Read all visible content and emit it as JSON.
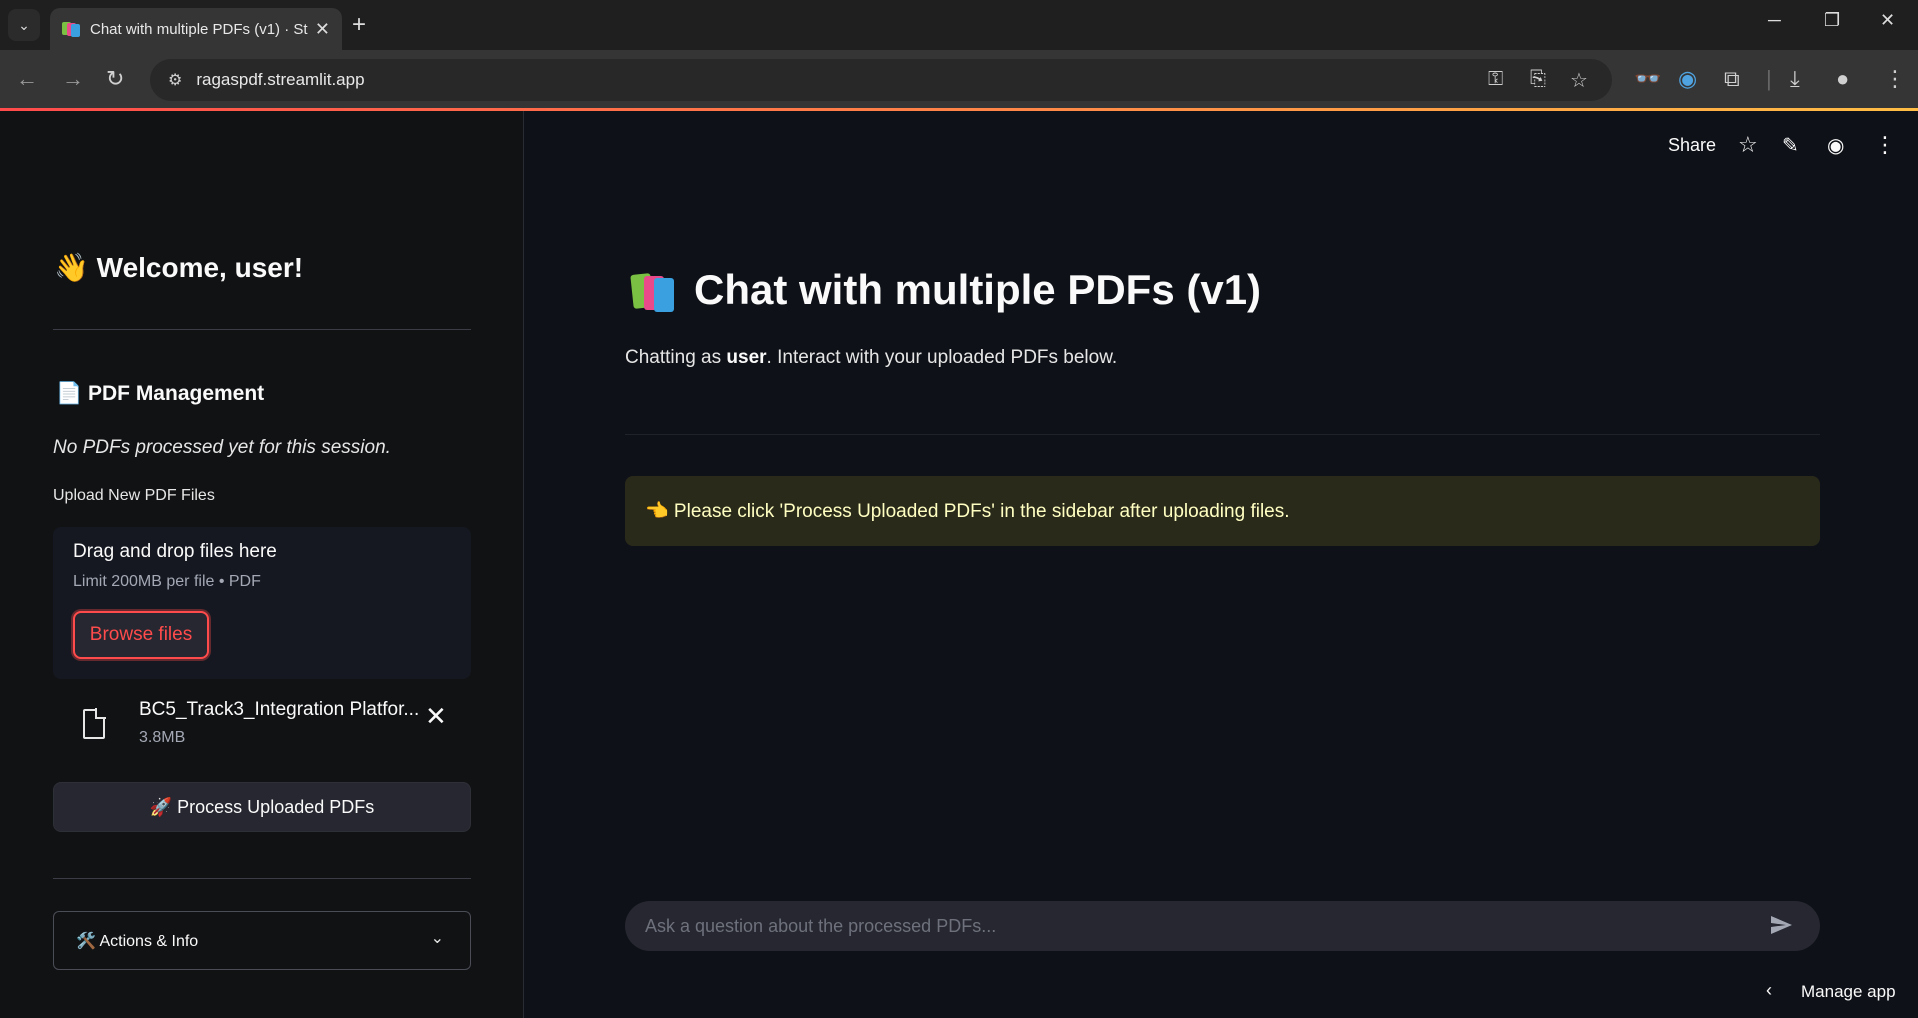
{
  "browser": {
    "tab_title": "Chat with multiple PDFs (v1) · St",
    "url": "ragaspdf.streamlit.app"
  },
  "sidebar": {
    "welcome": "👋 Welcome, user!",
    "pdf_management_heading": "📄 PDF Management",
    "no_pdfs_text": "No PDFs processed yet for this session.",
    "upload_label": "Upload New PDF Files",
    "dropzone": {
      "title": "Drag and drop files here",
      "limit": "Limit 200MB per file • PDF",
      "browse_label": "Browse files"
    },
    "file": {
      "name": "BC5_Track3_Integration Platfor...",
      "size": "3.8MB"
    },
    "process_button": "🚀 Process Uploaded PDFs",
    "expander_label": "🛠️ Actions & Info"
  },
  "header": {
    "share_label": "Share"
  },
  "main": {
    "title": "Chat with multiple PDFs (v1)",
    "subtitle_prefix": "Chatting as ",
    "subtitle_user": "user",
    "subtitle_suffix": ". Interact with your uploaded PDFs below.",
    "alert": "👈 Please click 'Process Uploaded PDFs' in the sidebar after uploading files.",
    "chat_placeholder": "Ask a question about the processed PDFs...",
    "manage_app": "Manage app"
  },
  "colors": {
    "accent": "#ff4b4b",
    "sidebar_bg": "#111214",
    "main_bg": "#0e1117",
    "alert_text": "#ffffc2"
  }
}
